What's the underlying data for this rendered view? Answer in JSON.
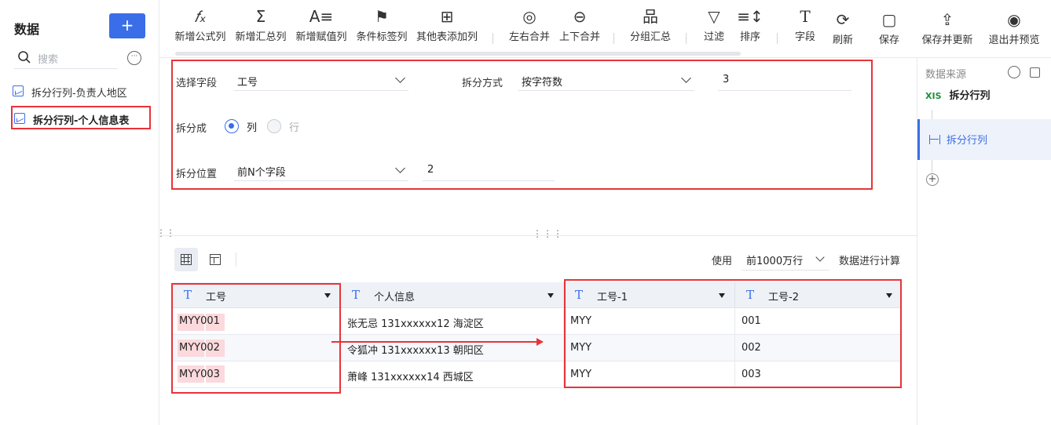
{
  "sidebar": {
    "title": "数据",
    "add_label": "+",
    "search_placeholder": "搜索",
    "items": [
      {
        "label": "拆分行列-负责人地区"
      },
      {
        "label": "拆分行列-个人信息表"
      }
    ]
  },
  "toolbar": {
    "buttons": [
      {
        "icon": "𝑓ₓ",
        "label": "新增公式列"
      },
      {
        "icon": "Σ",
        "label": "新增汇总列"
      },
      {
        "icon": "A≡",
        "label": "新增赋值列"
      },
      {
        "icon": "⚑",
        "label": "条件标签列"
      },
      {
        "icon": "⊞",
        "label": "其他表添加列"
      },
      {
        "icon": "◎",
        "label": "左右合并"
      },
      {
        "icon": "⊖",
        "label": "上下合并"
      },
      {
        "icon": "品",
        "label": "分组汇总"
      },
      {
        "icon": "▽",
        "label": "过滤"
      },
      {
        "icon": "≡↕",
        "label": "排序"
      },
      {
        "icon": "T",
        "label": "字段"
      }
    ]
  },
  "actions": [
    {
      "icon": "⟳",
      "label": "刷新"
    },
    {
      "icon": "▢",
      "label": "保存"
    },
    {
      "icon": "⇪",
      "label": "保存并更新"
    },
    {
      "icon": "◉",
      "label": "退出并预览"
    }
  ],
  "config": {
    "field_label": "选择字段",
    "field_value": "工号",
    "method_label": "拆分方式",
    "method_value": "按字符数",
    "method_count": "3",
    "split_into_label": "拆分成",
    "radio_col": "列",
    "radio_row": "行",
    "position_label": "拆分位置",
    "position_value": "前N个字段",
    "position_n": "2"
  },
  "preview": {
    "use_label": "使用",
    "rows_select": "前1000万行",
    "calc_label": "数据进行计算"
  },
  "table": {
    "columns": [
      {
        "type_icon": "T",
        "name": "工号"
      },
      {
        "type_icon": "T",
        "name": "个人信息"
      },
      {
        "type_icon": "T",
        "name": "工号-1"
      },
      {
        "type_icon": "T",
        "name": "工号-2"
      }
    ],
    "rows": [
      [
        "MYY001",
        "张无忌 131xxxxxx12 海淀区",
        "MYY",
        "001"
      ],
      [
        "MYY002",
        "令狐冲 131xxxxxx13 朝阳区",
        "MYY",
        "002"
      ],
      [
        "MYY003",
        "萧峰 131xxxxxx14 西城区",
        "MYY",
        "003"
      ]
    ]
  },
  "right_panel": {
    "title": "数据来源",
    "source_badge": "XIS",
    "source_name": "拆分行列",
    "step_name": "拆分行列"
  },
  "colors": {
    "accent": "#3a6ee8",
    "highlight_box": "#e8333a"
  }
}
